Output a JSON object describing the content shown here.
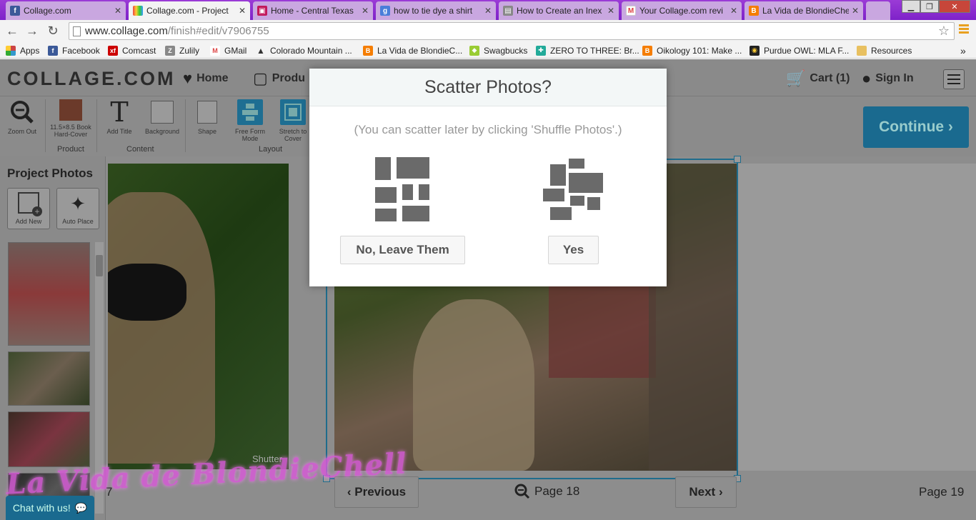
{
  "browser": {
    "tabs": [
      {
        "title": "Collage.com",
        "favicon": "facebook-icon",
        "color": "#3b5998",
        "active": false
      },
      {
        "title": "Collage.com - Project",
        "favicon": "collage-icon",
        "color": "#e44",
        "active": true
      },
      {
        "title": "Home - Central Texas",
        "favicon": "gift-icon",
        "color": "#c2185b",
        "active": false
      },
      {
        "title": "how to tie dye a shirt",
        "favicon": "google-icon",
        "color": "#4a7ed9",
        "active": false
      },
      {
        "title": "How to Create an Inex",
        "favicon": "doc-icon",
        "color": "#888",
        "active": false
      },
      {
        "title": "Your Collage.com revi",
        "favicon": "gmail-icon",
        "color": "#d44",
        "active": false
      },
      {
        "title": "La Vida de BlondieChe",
        "favicon": "blogger-icon",
        "color": "#f57d00",
        "active": false
      }
    ],
    "url_host": "www.collage.com",
    "url_path": "/finish#edit/v7906755",
    "bookmarks": [
      {
        "label": "Apps",
        "icon": "apps-grid-icon",
        "color": "#c44"
      },
      {
        "label": "Facebook",
        "icon": "facebook-icon",
        "color": "#3b5998"
      },
      {
        "label": "Comcast",
        "icon": "xfinity-icon",
        "color": "#c00"
      },
      {
        "label": "Zulily",
        "icon": "zulily-icon",
        "color": "#888"
      },
      {
        "label": "GMail",
        "icon": "gmail-icon",
        "color": "#d44"
      },
      {
        "label": "Colorado Mountain ...",
        "icon": "mountain-icon",
        "color": "#333"
      },
      {
        "label": "La Vida de BlondieC...",
        "icon": "blogger-icon",
        "color": "#f57d00"
      },
      {
        "label": "Swagbucks",
        "icon": "swagbucks-icon",
        "color": "#9c3"
      },
      {
        "label": "ZERO TO THREE: Br...",
        "icon": "zerotothree-icon",
        "color": "#2a9"
      },
      {
        "label": "Oikology 101: Make ...",
        "icon": "blogger-icon",
        "color": "#f57d00"
      },
      {
        "label": "Purdue OWL: MLA F...",
        "icon": "owl-icon",
        "color": "#222"
      },
      {
        "label": "Resources",
        "icon": "folder-icon",
        "color": "#e8c060"
      }
    ]
  },
  "site": {
    "logo": "COLLAGE.COM",
    "nav": {
      "home": "Home",
      "products": "Produ",
      "cart": "Cart (1)",
      "signin": "Sign In"
    },
    "tools": [
      {
        "label": "Zoom Out",
        "icon": "zoom-out-icon"
      },
      {
        "label": "11.5×8.5 Book Hard-Cover",
        "icon": "book-icon"
      },
      {
        "label": "Add Title",
        "icon": "text-icon"
      },
      {
        "label": "Background",
        "icon": "background-icon"
      },
      {
        "label": "Shape",
        "icon": "shape-icon"
      },
      {
        "label": "Free Form Mode",
        "icon": "free-form-icon"
      },
      {
        "label": "Stretch to Cover",
        "icon": "stretch-icon"
      }
    ],
    "groups": {
      "product": "Product",
      "content": "Content",
      "layout": "Layout"
    },
    "continue": "Continue ›",
    "sidebar": {
      "title": "Project Photos",
      "add_new": "Add New",
      "auto_place": "Auto Place"
    },
    "canvas": {
      "left_photo_caption": "Shutter",
      "previous": "‹ Previous",
      "next": "Next ›",
      "page_current": "Page 18",
      "page_next": "Page 19",
      "page_prev_fragment": "7"
    },
    "chat": "Chat with us!",
    "watermark": "La Vida de BlondieChell"
  },
  "modal": {
    "title": "Scatter Photos?",
    "subtitle": "(You can scatter later by clicking 'Shuffle Photos'.)",
    "no_button": "No, Leave Them",
    "yes_button": "Yes"
  }
}
